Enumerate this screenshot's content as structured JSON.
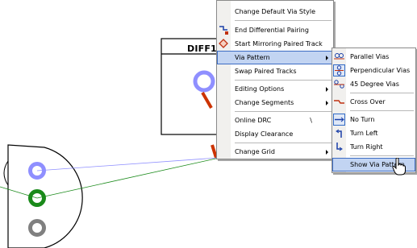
{
  "component": {
    "label": "DIFF1"
  },
  "context_menu": {
    "items": [
      {
        "label": "Change Default Via Style",
        "icon": "none"
      },
      {
        "label": "End Differential Pairing",
        "icon": "end-diff-pair-icon"
      },
      {
        "label": "Start Mirroring Paired Track",
        "icon": "mirror-track-icon"
      },
      {
        "label": "Via Pattern",
        "icon": "none",
        "submenu": true,
        "highlighted": true
      },
      {
        "label": "Swap Paired Tracks",
        "icon": "none"
      },
      {
        "label": "Editing Options",
        "icon": "none",
        "submenu": true
      },
      {
        "label": "Change Segments",
        "icon": "none",
        "submenu": true
      },
      {
        "label": "Online DRC",
        "icon": "none",
        "shortcut": "\\"
      },
      {
        "label": "Display Clearance",
        "icon": "none"
      },
      {
        "label": "Change Grid",
        "icon": "none",
        "submenu": true
      }
    ]
  },
  "via_submenu": {
    "items": [
      {
        "label": "Parallel Vias",
        "icon": "parallel-vias-icon"
      },
      {
        "label": "Perpendicular Vias",
        "icon": "perpendicular-vias-icon",
        "checked": true
      },
      {
        "label": "45 Degree Vias",
        "icon": "45-degree-vias-icon"
      },
      {
        "label": "Cross Over",
        "icon": "cross-over-icon"
      },
      {
        "label": "No Turn",
        "icon": "no-turn-icon",
        "checked": true
      },
      {
        "label": "Turn Left",
        "icon": "turn-left-icon"
      },
      {
        "label": "Turn Right",
        "icon": "turn-right-icon"
      },
      {
        "label": "Show Via Pattern",
        "icon": "none",
        "highlighted": true
      }
    ]
  },
  "colors": {
    "via_blue": "#8f8fff",
    "pad_green": "#1a8a1a",
    "pad_gray": "#808080",
    "track_red": "#cc3300",
    "menu_highlight": "#c2d4f2"
  }
}
